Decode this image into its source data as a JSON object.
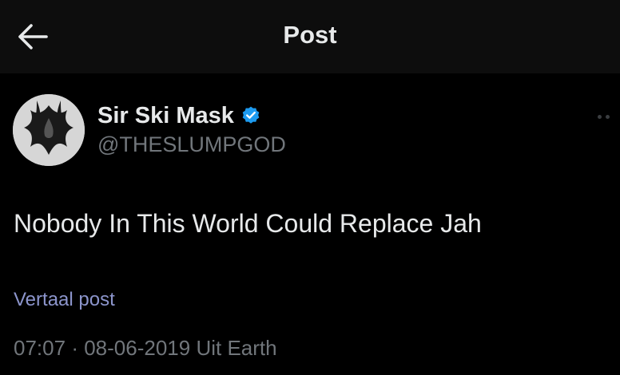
{
  "header": {
    "back_icon": "arrow-left-icon",
    "title": "Post"
  },
  "author": {
    "display_name": "Sir Ski Mask",
    "handle": "@THESLUMPGOD",
    "verified_icon": "verified-badge-icon",
    "verified_color": "#1d9bf0"
  },
  "post": {
    "text": "Nobody In This World Could Replace Jah",
    "translate_label": "Vertaal post",
    "time": "07:07",
    "separator": "·",
    "date": "08-06-2019",
    "source": "Uit Earth"
  },
  "colors": {
    "background": "#000000",
    "header_background": "#0d0d0d",
    "primary_text": "#e7e9ea",
    "secondary_text": "#71767b",
    "link": "#8c95cc"
  }
}
